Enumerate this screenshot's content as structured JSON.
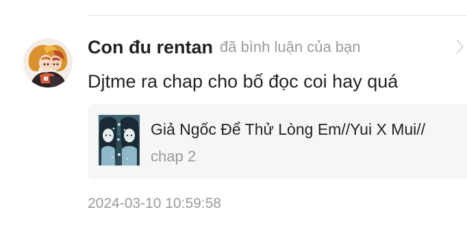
{
  "notification": {
    "user_name": "Con đu rentan",
    "action_text": "đã bình luận của bạn",
    "comment": "Djtme ra chap cho bố đọc coi hay quá",
    "story": {
      "title": "Giả Ngốc Để Thử Lòng Em//Yui X Mui//",
      "chapter": "chap 2"
    },
    "timestamp": "2024-03-10 10:59:58"
  },
  "icons": {
    "avatar": "user-avatar",
    "chevron": "chevron-right-icon",
    "cover": "story-cover-image"
  },
  "colors": {
    "primary_text": "#222222",
    "secondary_text": "#9a9a9a",
    "card_background": "#f6f6f6",
    "divider": "#e6e6e6"
  }
}
